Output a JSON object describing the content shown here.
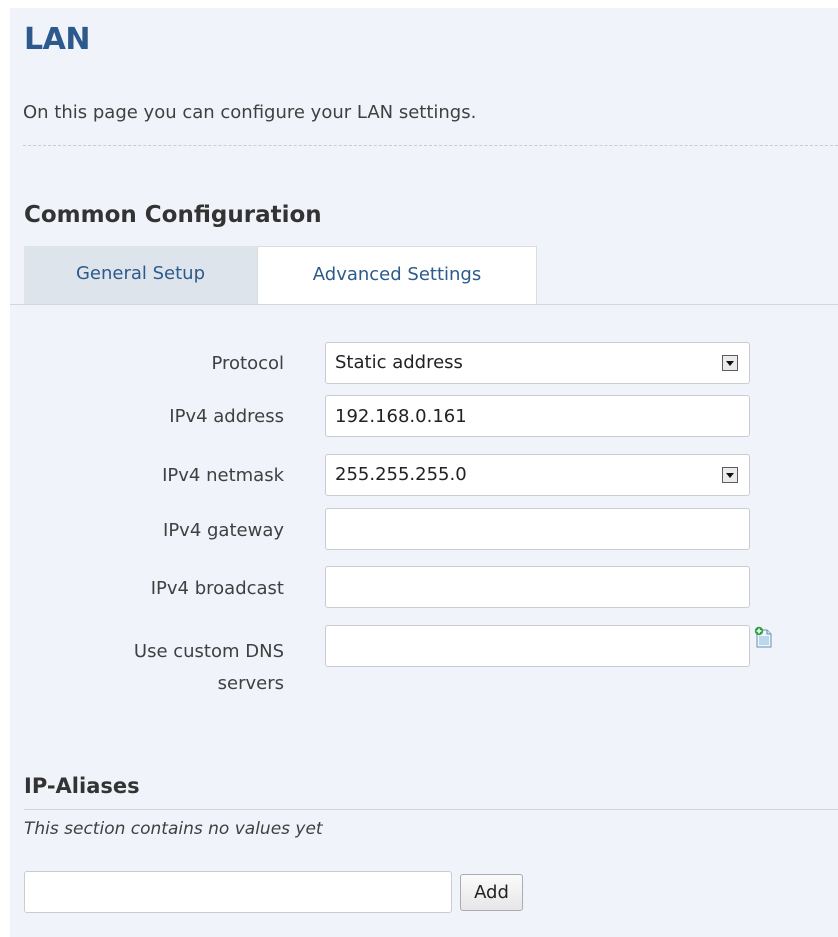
{
  "page": {
    "title": "LAN",
    "description": "On this page you can configure your LAN settings."
  },
  "section": {
    "title": "Common Configuration",
    "tabs": [
      {
        "label": "General Setup",
        "active": false
      },
      {
        "label": "Advanced Settings",
        "active": true
      }
    ]
  },
  "form": {
    "protocol": {
      "label": "Protocol",
      "value": "Static address"
    },
    "ipv4_address": {
      "label": "IPv4 address",
      "value": "192.168.0.161"
    },
    "ipv4_netmask": {
      "label": "IPv4 netmask",
      "value": "255.255.255.0"
    },
    "ipv4_gateway": {
      "label": "IPv4 gateway",
      "value": ""
    },
    "ipv4_broadcast": {
      "label": "IPv4 broadcast",
      "value": ""
    },
    "custom_dns": {
      "label_line1": "Use custom DNS",
      "label_line2": "servers",
      "value": "",
      "add_icon": "add-document-icon"
    }
  },
  "ip_aliases": {
    "title": "IP-Aliases",
    "empty_note": "This section contains no values yet",
    "input_value": "",
    "add_label": "Add"
  },
  "colors": {
    "panel_bg": "#f0f3fa",
    "title": "#2c5a8c",
    "tab_inactive_bg": "#dde4ec",
    "tab_text": "#2c5a8c"
  }
}
